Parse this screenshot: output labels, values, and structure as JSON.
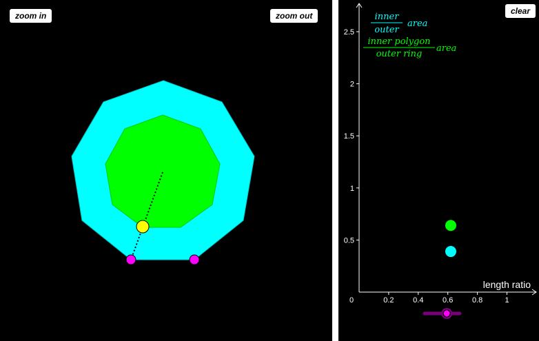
{
  "toolbar": {
    "zoom_in_label": "zoom in",
    "zoom_out_label": "zoom out",
    "clear_label": "clear"
  },
  "colors": {
    "background": "#000000",
    "outer_polygon": "#00ffff",
    "inner_polygon": "#00ff00",
    "vertex_point": "#ff00ff",
    "center_handle": "#ffff00",
    "slider": "#7a007a"
  },
  "legend": {
    "ratio1_numerator": "inner",
    "ratio1_denominator": "outer",
    "ratio1_suffix": "area",
    "ratio2_numerator": "inner polygon",
    "ratio2_denominator": "outer ring",
    "ratio2_suffix": "area"
  },
  "slider": {
    "value": 0.62
  },
  "chart_data": {
    "type": "scatter",
    "xlabel": "length ratio",
    "ylabel": "",
    "origin_label": "0",
    "x_ticks": [
      "0.2",
      "0.4",
      "0.6",
      "0.8",
      "1"
    ],
    "y_ticks": [
      "0.5",
      "1",
      "1.5",
      "2",
      "2.5"
    ],
    "xlim": [
      0,
      1.2
    ],
    "ylim": [
      0,
      2.75
    ],
    "series": [
      {
        "color": "#00ffff",
        "points": [
          [
            0.62,
            0.39
          ]
        ]
      },
      {
        "color": "#00ff00",
        "points": [
          [
            0.62,
            0.64
          ]
        ]
      }
    ]
  }
}
